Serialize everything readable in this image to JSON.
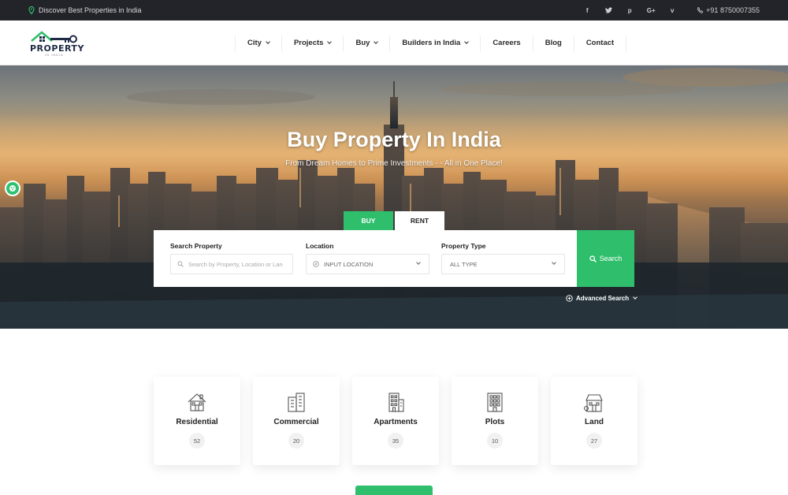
{
  "topbar": {
    "tagline": "Discover Best Properties in India",
    "social": [
      "f",
      "t",
      "p",
      "G+",
      "v"
    ],
    "phone": "+91 8750007355"
  },
  "logo": {
    "text": "PROPERTY",
    "subtext": "IN INDIA"
  },
  "nav": [
    {
      "label": "City",
      "dropdown": true
    },
    {
      "label": "Projects",
      "dropdown": true
    },
    {
      "label": "Buy",
      "dropdown": true
    },
    {
      "label": "Builders in India",
      "dropdown": true
    },
    {
      "label": "Careers",
      "dropdown": false
    },
    {
      "label": "Blog",
      "dropdown": false
    },
    {
      "label": "Contact",
      "dropdown": false
    }
  ],
  "hero": {
    "title": "Buy Property In India",
    "subtitle": "From Dream Homes to Prime Investments - - All in One Place!"
  },
  "search": {
    "tabs": [
      "BUY",
      "RENT"
    ],
    "property_label": "Search Property",
    "property_placeholder": "Search by Property, Location or Landmark",
    "location_label": "Location",
    "location_value": "INPUT LOCATION",
    "type_label": "Property Type",
    "type_value": "ALL TYPE",
    "button": "Search",
    "advanced": "Advanced Search"
  },
  "categories": [
    {
      "label": "Residential",
      "count": "52",
      "icon": "house-icon"
    },
    {
      "label": "Commercial",
      "count": "20",
      "icon": "office-building-icon"
    },
    {
      "label": "Apartments",
      "count": "35",
      "icon": "apartment-icon"
    },
    {
      "label": "Plots",
      "count": "10",
      "icon": "plot-building-icon"
    },
    {
      "label": "Land",
      "count": "27",
      "icon": "land-icon"
    }
  ],
  "colors": {
    "accent": "#2fbf6c",
    "topbar": "#23232a"
  }
}
